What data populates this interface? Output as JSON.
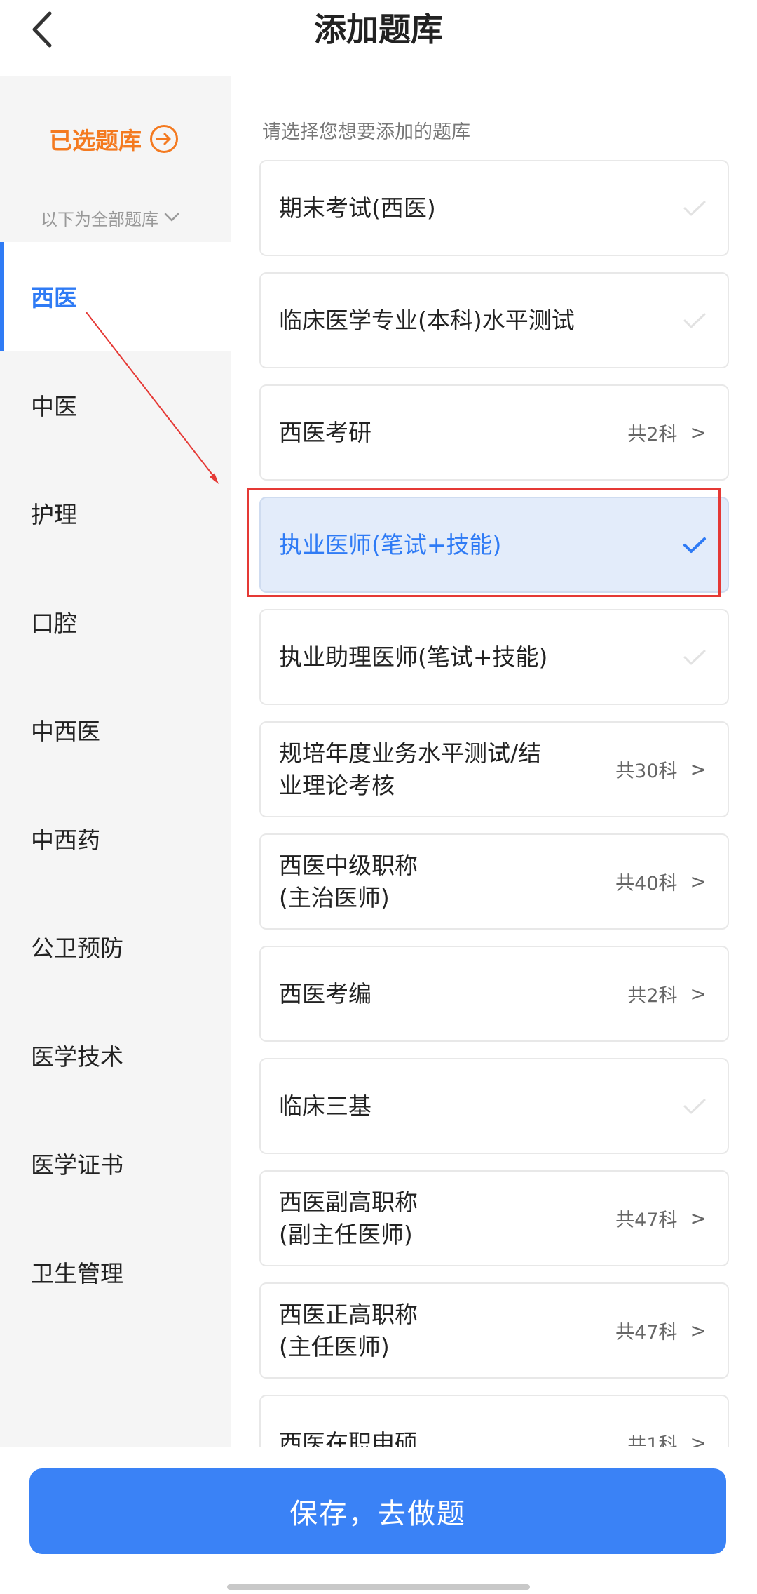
{
  "header": {
    "title": "添加题库"
  },
  "sidebar": {
    "selected_link": "已选题库",
    "all_label": "以下为全部题库",
    "categories": [
      {
        "label": "西医"
      },
      {
        "label": "中医"
      },
      {
        "label": "护理"
      },
      {
        "label": "口腔"
      },
      {
        "label": "中西医"
      },
      {
        "label": "中西药"
      },
      {
        "label": "公卫预防"
      },
      {
        "label": "医学技术"
      },
      {
        "label": "医学证书"
      },
      {
        "label": "卫生管理"
      }
    ],
    "active_index": 0
  },
  "main": {
    "hint": "请选择您想要添加的题库",
    "cards": [
      {
        "name": "期末考试(西医)",
        "count": "",
        "arrow": "",
        "state": "unchecked"
      },
      {
        "name": "临床医学专业(本科)水平测试",
        "count": "",
        "arrow": "",
        "state": "unchecked"
      },
      {
        "name": "西医考研",
        "count": "共2科",
        "arrow": ">",
        "state": "more"
      },
      {
        "name": "执业医师(笔试+技能)",
        "count": "",
        "arrow": "",
        "state": "checked"
      },
      {
        "name": "执业助理医师(笔试+技能)",
        "count": "",
        "arrow": "",
        "state": "unchecked"
      },
      {
        "name": "规培年度业务水平测试/结\n业理论考核",
        "count": "共30科",
        "arrow": ">",
        "state": "more"
      },
      {
        "name": "西医中级职称\n(主治医师)",
        "count": "共40科",
        "arrow": ">",
        "state": "more"
      },
      {
        "name": "西医考编",
        "count": "共2科",
        "arrow": ">",
        "state": "more"
      },
      {
        "name": "临床三基",
        "count": "",
        "arrow": "",
        "state": "unchecked"
      },
      {
        "name": "西医副高职称\n(副主任医师)",
        "count": "共47科",
        "arrow": ">",
        "state": "more"
      },
      {
        "name": "西医正高职称\n(主任医师)",
        "count": "共47科",
        "arrow": ">",
        "state": "more"
      },
      {
        "name": "西医在职申硕",
        "count": "共1科",
        "arrow": ">",
        "state": "more"
      }
    ]
  },
  "footer": {
    "save_label": "保存，去做题"
  },
  "colors": {
    "accent_blue": "#2f7bf5",
    "button_blue": "#3a82f6",
    "orange": "#f47a20",
    "annotation_red": "#e53935",
    "selected_bg": "#e3ecfa"
  },
  "icons": {
    "back": "chevron-left-icon",
    "selected_link": "arrow-right-circle-icon",
    "all_banks": "chevron-down-icon",
    "card_check": "check-icon"
  }
}
